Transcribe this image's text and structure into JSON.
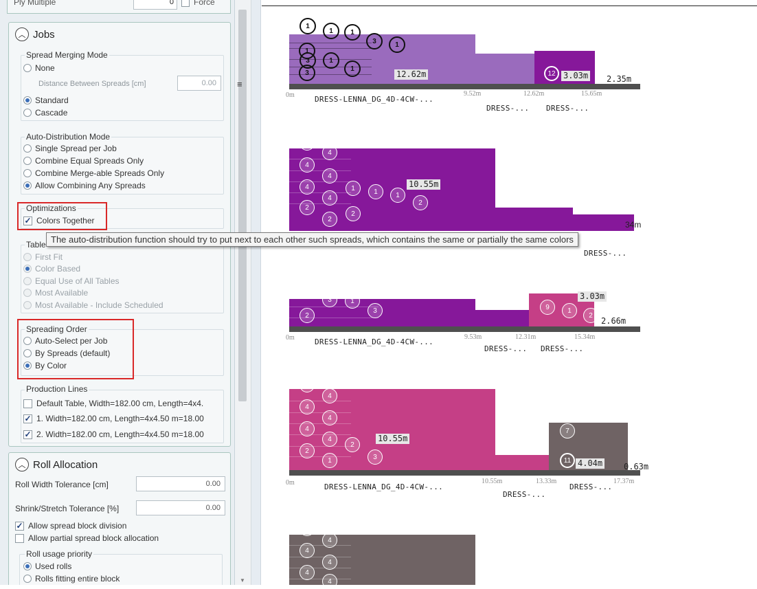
{
  "left_panel": {
    "ply_multiple": {
      "label": "Ply Multiple",
      "value": "0",
      "force_label": "Force"
    },
    "jobs": {
      "title": "Jobs",
      "spread_merging": {
        "title": "Spread Merging Mode",
        "none": "None",
        "distance_label": "Distance Between Spreads [cm]",
        "distance_value": "0.00",
        "standard": "Standard",
        "cascade": "Cascade"
      },
      "auto_distribution": {
        "title": "Auto-Distribution Mode",
        "options": [
          "Single Spread per Job",
          "Combine Equal Spreads Only",
          "Combine Merge-able Spreads Only",
          "Allow Combining Any Spreads"
        ]
      },
      "optimizations": {
        "title": "Optimizations",
        "colors_together": "Colors Together"
      },
      "table": {
        "title": "Table",
        "options": [
          "First Fit",
          "Color Based",
          "Equal Use of All Tables",
          "Most Available",
          "Most Available - Include Scheduled"
        ]
      },
      "spreading_order": {
        "title": "Spreading Order",
        "options": [
          "Auto-Select per Job",
          "By Spreads (default)",
          "By Color"
        ]
      },
      "production_lines": {
        "title": "Production Lines",
        "items": [
          "Default Table, Width=182.00 cm, Length=4x4.",
          "1. Width=182.00 cm, Length=4x4.50 m=18.00",
          "2. Width=182.00 cm, Length=4x4.50 m=18.00"
        ]
      }
    },
    "roll_allocation": {
      "title": "Roll Allocation",
      "roll_width_label": "Roll Width Tolerance [cm]",
      "roll_width_value": "0.00",
      "shrink_label": "Shrink/Stretch Tolerance [%]",
      "shrink_value": "0.00",
      "allow_division": "Allow spread block division",
      "allow_partial": "Allow partial spread block allocation",
      "usage_title": "Roll usage priority",
      "usage_options": [
        "Used rolls",
        "Rolls fitting entire block"
      ]
    }
  },
  "tooltip": "The auto-distribution function should try to put next to each other such spreads, which contains the same or partially the same colors",
  "splitter_glyph": "≡",
  "charts": [
    {
      "labels": {
        "main": "12.62m",
        "second": "3.03m",
        "third": "2.35m",
        "num": "12"
      },
      "ticks": [
        "0m",
        "9.52m",
        "12.62m",
        "15.65m"
      ],
      "names": [
        "DRESS-LENNA_DG_4D-4CW-...",
        "DRESS-...",
        "DRESS-..."
      ],
      "circles_top": [
        "1",
        "1",
        "1",
        "3",
        "1"
      ],
      "circles_mid": [
        "1",
        "1",
        "1"
      ],
      "circles_bot": [
        "3",
        "3"
      ]
    },
    {
      "labels": {
        "main": "10.55m",
        "end": "34m",
        "name_below": "DRESS-..."
      },
      "circles_a": [
        "2",
        "4",
        "4",
        "4",
        "4"
      ],
      "circles_b": [
        "4",
        "1",
        "1",
        "1",
        "2",
        "2",
        "2"
      ],
      "circles_c": [
        "2"
      ]
    },
    {
      "labels": {
        "first": "3.03m",
        "second": "2.66m"
      },
      "ticks": [
        "0m",
        "9.53m",
        "12.31m",
        "15.34m"
      ],
      "names": [
        "DRESS-LENNA_DG_4D-4CW-...",
        "DRESS-...",
        "DRESS-..."
      ],
      "circles": [
        "1",
        "3",
        "1",
        "2",
        "3",
        "9",
        "1",
        "2"
      ]
    },
    {
      "labels": {
        "main": "10.55m",
        "second": "4.04m",
        "third": "0.63m",
        "num": "11",
        "seven": "7"
      },
      "ticks": [
        "0m",
        "10.55m",
        "13.33m",
        "17.37m"
      ],
      "names": [
        "DRESS-LENNA_DG_4D-4CW-...",
        "DRESS-...",
        "DRESS-..."
      ],
      "circles": [
        "2",
        "4",
        "4",
        "4",
        "4",
        "4",
        "2",
        "1",
        "3"
      ]
    },
    {
      "circles": [
        "2",
        "4",
        "4",
        "4",
        "4"
      ]
    }
  ],
  "colors": {
    "lavender": "#9a6bbd",
    "purple": "#86189a",
    "magenta": "#c53f86",
    "gray": "#6f6364",
    "highlight": "#d92828"
  }
}
